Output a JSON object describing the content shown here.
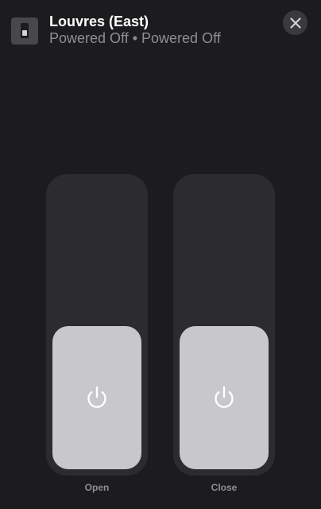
{
  "header": {
    "icon": "switch-icon",
    "title": "Louvres (East)",
    "subtitle": "Powered Off • Powered Off"
  },
  "close_icon": "close-icon",
  "controls": [
    {
      "label": "Open",
      "state": "off",
      "level_percent": 0,
      "icon": "power-icon"
    },
    {
      "label": "Close",
      "state": "off",
      "level_percent": 0,
      "icon": "power-icon"
    }
  ],
  "colors": {
    "background": "#1c1c1e",
    "track": "#2c2c2e",
    "fill": "#c7c7cc",
    "secondary_text": "#8e8e93"
  }
}
